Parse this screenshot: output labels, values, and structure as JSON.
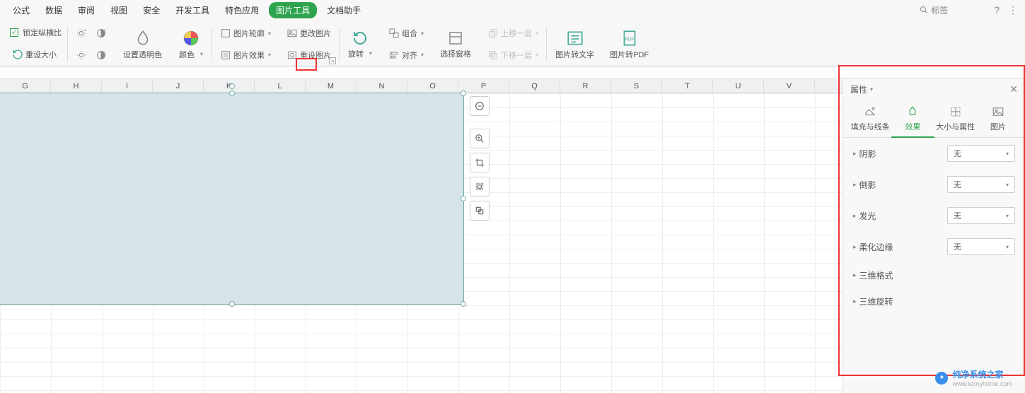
{
  "menu": {
    "items": [
      "公式",
      "数据",
      "审阅",
      "视图",
      "安全",
      "开发工具",
      "特色应用",
      "图片工具",
      "文档助手"
    ],
    "active_index": 7,
    "search_placeholder": "标签"
  },
  "ribbon": {
    "lock_ratio": "锁定纵横比",
    "reset_size": "重设大小",
    "set_transparent": "设置透明色",
    "color": "颜色",
    "pic_outline": "图片轮廓",
    "pic_effect": "图片效果",
    "change_pic": "更改图片",
    "reset_pic": "重设图片",
    "rotate": "旋转",
    "group": "组合",
    "align": "对齐",
    "select_pane": "选择窗格",
    "bring_forward": "上移一层",
    "send_backward": "下移一层",
    "pic_to_text": "图片转文字",
    "pic_to_pdf": "图片转PDF"
  },
  "columns": [
    "G",
    "H",
    "I",
    "J",
    "K",
    "L",
    "M",
    "N",
    "O",
    "P",
    "Q",
    "R",
    "S",
    "T",
    "U",
    "V"
  ],
  "panel": {
    "title": "属性",
    "tabs": [
      "填充与线条",
      "效果",
      "大小与属性",
      "图片"
    ],
    "active_tab": 1,
    "sections": {
      "shadow": {
        "label": "阴影",
        "value": "无"
      },
      "reflection": {
        "label": "倒影",
        "value": "无"
      },
      "glow": {
        "label": "发光",
        "value": "无"
      },
      "soft_edge": {
        "label": "柔化边缘",
        "value": "无"
      },
      "3d_format": {
        "label": "三维格式"
      },
      "3d_rotate": {
        "label": "三维旋转"
      }
    }
  },
  "watermark": {
    "title": "纯净系统之家",
    "url": "www.kzmyhome.com"
  }
}
